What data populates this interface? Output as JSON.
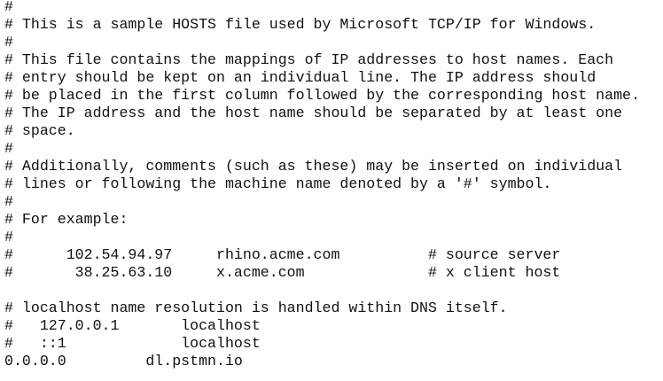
{
  "document": {
    "filename": "",
    "lines": [
      "#",
      "# This is a sample HOSTS file used by Microsoft TCP/IP for Windows.",
      "#",
      "# This file contains the mappings of IP addresses to host names. Each",
      "# entry should be kept on an individual line. The IP address should",
      "# be placed in the first column followed by the corresponding host name.",
      "# The IP address and the host name should be separated by at least one",
      "# space.",
      "#",
      "# Additionally, comments (such as these) may be inserted on individual",
      "# lines or following the machine name denoted by a '#' symbol.",
      "#",
      "# For example:",
      "#",
      "#      102.54.94.97     rhino.acme.com          # source server",
      "#       38.25.63.10     x.acme.com              # x client host",
      "",
      "# localhost name resolution is handled within DNS itself.",
      "#   127.0.0.1       localhost",
      "#   ::1             localhost",
      "0.0.0.0         dl.pstmn.io"
    ]
  }
}
